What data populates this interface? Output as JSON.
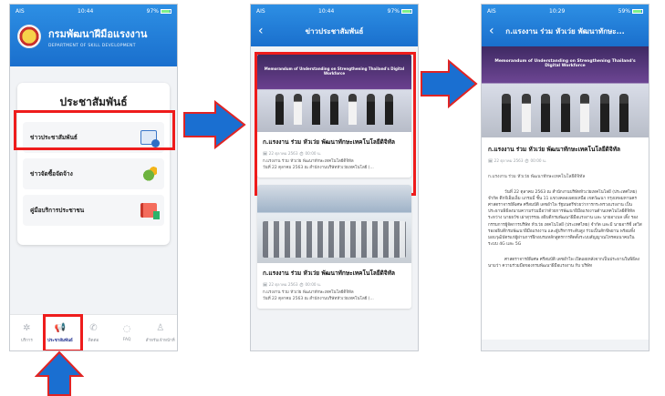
{
  "phone1": {
    "status": {
      "carrier": "AIS",
      "time": "10:44",
      "battery": "97%"
    },
    "header": {
      "title_th": "กรมพัฒนาฝีมือแรงงาน",
      "title_en": "DEPARTMENT OF SKILL DEVELOPMENT"
    },
    "menu": {
      "title": "ประชาสัมพันธ์",
      "items": [
        {
          "label": "ข่าวประชาสัมพันธ์",
          "icon": "newspaper-icon"
        },
        {
          "label": "ข่าวจัดซื้อจัดจ้าง",
          "icon": "money-bag-icon"
        },
        {
          "label": "คู่มือบริการประชาชน",
          "icon": "manual-book-icon"
        }
      ]
    },
    "tabs": [
      {
        "label": "บริการ",
        "icon": "gear-icon"
      },
      {
        "label": "ประชาสัมพันธ์",
        "icon": "megaphone-icon"
      },
      {
        "label": "ติดต่อ",
        "icon": "phone-icon"
      },
      {
        "label": "FAQ",
        "icon": "chat-icon"
      },
      {
        "label": "สำหรับเจ้าหน้าที่",
        "icon": "staff-icon"
      }
    ]
  },
  "phone2": {
    "status": {
      "carrier": "AIS",
      "time": "10:44",
      "battery": "97%"
    },
    "header": {
      "title": "ข่าวประชาสัมพันธ์"
    },
    "news": [
      {
        "banner": "Memorandum of Understanding on Strengthening Thailand's Digital Workforce",
        "title": "ก.แรงงาน ร่วม หัวเว่ย พัฒนาทักษะเทคโนโลยีดิจิทัล",
        "date": "22 ตุลาคม 2563",
        "time": "00:00 น.",
        "snippet": "ก.แรงงาน ร่วม หัวเว่ย พัฒนาทักษะเทคโนโลยีดิจิทัล\nวันที่ 22 ตุลาคม 2563 ณ สำนักงานบริษัทหัวเว่ยเทคโนโลยี (..."
      },
      {
        "title": "ก.แรงงาน ร่วม หัวเว่ย พัฒนาทักษะเทคโนโลยีดิจิทัล",
        "date": "22 ตุลาคม 2563",
        "time": "00:00 น.",
        "snippet": "ก.แรงงาน ร่วม หัวเว่ย พัฒนาทักษะเทคโนโลยีดิจิทัล\nวันที่ 22 ตุลาคม 2563 ณ สำนักงานบริษัทหัวเว่ยเทคโนโลยี (..."
      }
    ]
  },
  "phone3": {
    "status": {
      "carrier": "AIS",
      "time": "10:29",
      "battery": "59%"
    },
    "header": {
      "title": "ก.แรงงาน ร่วม หัวเว่ย พัฒนาทักษะ..."
    },
    "banner": "Memorandum of Understanding on Strengthening Thailand's Digital Workforce",
    "article": {
      "title": "ก.แรงงาน ร่วม หัวเว่ย พัฒนาทักษะเทคโนโลยีดิจิทัล",
      "date": "22 ตุลาคม 2563",
      "time": "00:00 น.",
      "subtitle": "ก.แรงงาน ร่วม หัวเว่ย พัฒนาทักษะเทคโนโลยีดิจิทัล",
      "para1": "วันที่ 22 ตุลาคม 2563 ณ สำนักงานบริษัทหัวเว่ยเทคโนโลยี (ประเทศไทย) จำกัด ตึกจีเอ็มเอ็ม แกรมมี่ ชั้น 11 แขวงคลองเตยเหนือ เขตวัฒนา กรุงเทพมหานคร ศาสตราจารย์พิเศษ ศรีสมบัติ เดชอำไพ รัฐมนตรีช่วยว่าการกระทรวงแรงงาน เป็นประธานพิธีลงนามความร่วมมือว่าด้วยการพัฒนาฝีมือแรงงานด้านเทคโนโลยีดิจิทัล ระหว่าง นายธวัช เผ่าสุวรรณ อธิบดีกรมพัฒนาฝีมือแรงงาน และ นายอาเบล เติ้ง รองกรรมการผู้จัดการบริษัท หัวเว่ย เทคโนโลยี (ประเทศไทย) จำกัด และมี นายอาร์ชี่ เดวิส รองอธิบดีกรมพัฒนาฝีมือแรงงาน และผู้บริหารระดับสูง ร่วมเป็นสักขีพยาน พร้อมทั้งมอบวุฒิบัตรแก่ผู้ผ่านการฝึกอบรมหลักสูตรการติดตั้งระบบสัญญาณโทรคมนาคมในระบบ 4G และ 5G",
      "para2": "ศาสตราจารย์พิเศษ ศรีสมบัติ เดชอำไพ เปิดเผยหลังจากเป็นประธานในพิธีลงนามว่า ความร่วมมือของกรมพัฒนาฝีมือแรงงาน กับ บริษัท"
    }
  },
  "annotations": {
    "highlight_color": "#ee1c1c",
    "arrow_color": "#1a6fd1",
    "arrow_outline": "#e02424"
  }
}
